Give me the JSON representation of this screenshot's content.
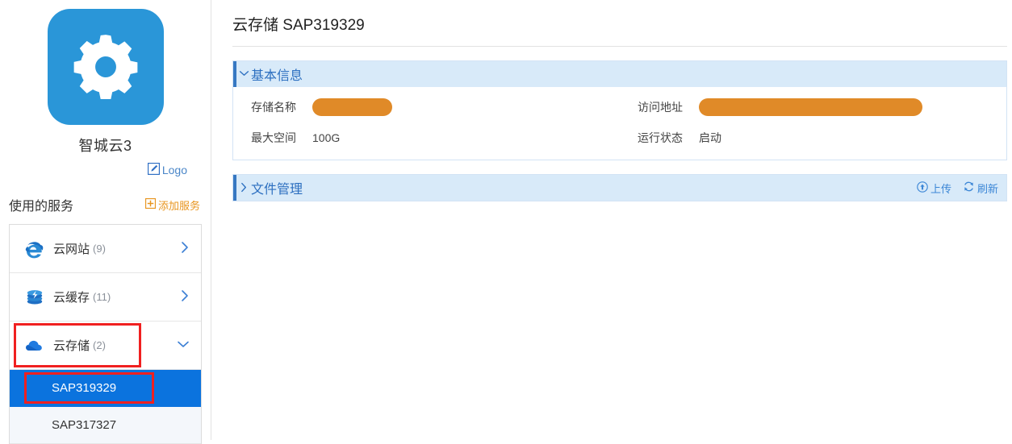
{
  "sidebar": {
    "brand": {
      "name": "智城云3",
      "logo_icon": "gear-icon",
      "logo_bg": "#2a96d8",
      "edit_logo_label": "Logo",
      "edit_logo_icon": "edit-square-icon"
    },
    "services_header": {
      "title": "使用的服务",
      "add_label": "添加服务",
      "add_icon": "plus-square-icon",
      "add_color": "#e8951e"
    },
    "services": [
      {
        "label": "云网站",
        "count": "(9)",
        "icon": "internet-explorer-icon",
        "chevron": "chevron-right-icon",
        "expanded": false,
        "highlighted": false
      },
      {
        "label": "云缓存",
        "count": "(11)",
        "icon": "database-icon",
        "chevron": "chevron-right-icon",
        "expanded": false,
        "highlighted": false
      },
      {
        "label": "云存储",
        "count": "(2)",
        "icon": "cloud-icon",
        "chevron": "chevron-down-icon",
        "expanded": true,
        "highlighted": true
      }
    ],
    "sub_items": [
      {
        "label": "SAP319329",
        "selected": true,
        "highlighted": true
      },
      {
        "label": "SAP317327",
        "selected": false,
        "highlighted": false
      }
    ]
  },
  "main": {
    "page_title": "云存储 SAP319329",
    "basic_panel": {
      "title": "基本信息",
      "toggle_icon": "chevron-down-icon",
      "expanded": true,
      "fields": [
        {
          "label": "存储名称",
          "value": "",
          "redacted": true,
          "redact_width": "name"
        },
        {
          "label": "访问地址",
          "value": "",
          "redacted": true,
          "redact_width": "url"
        },
        {
          "label": "最大空间",
          "value": "100G",
          "redacted": false
        },
        {
          "label": "运行状态",
          "value": "启动",
          "redacted": false
        }
      ]
    },
    "file_panel": {
      "title": "文件管理",
      "toggle_icon": "chevron-right-icon",
      "expanded": false,
      "actions": [
        {
          "label": "上传",
          "icon": "upload-circle-icon"
        },
        {
          "label": "刷新",
          "icon": "refresh-icon"
        }
      ]
    }
  },
  "colors": {
    "accent_blue": "#2c6fc0",
    "panel_header_bg": "#d8eaf9",
    "selected_row_bg": "#0b73de",
    "redaction_orange": "#e08a28",
    "highlight_red": "#f02020",
    "add_service_orange": "#e8951e"
  }
}
